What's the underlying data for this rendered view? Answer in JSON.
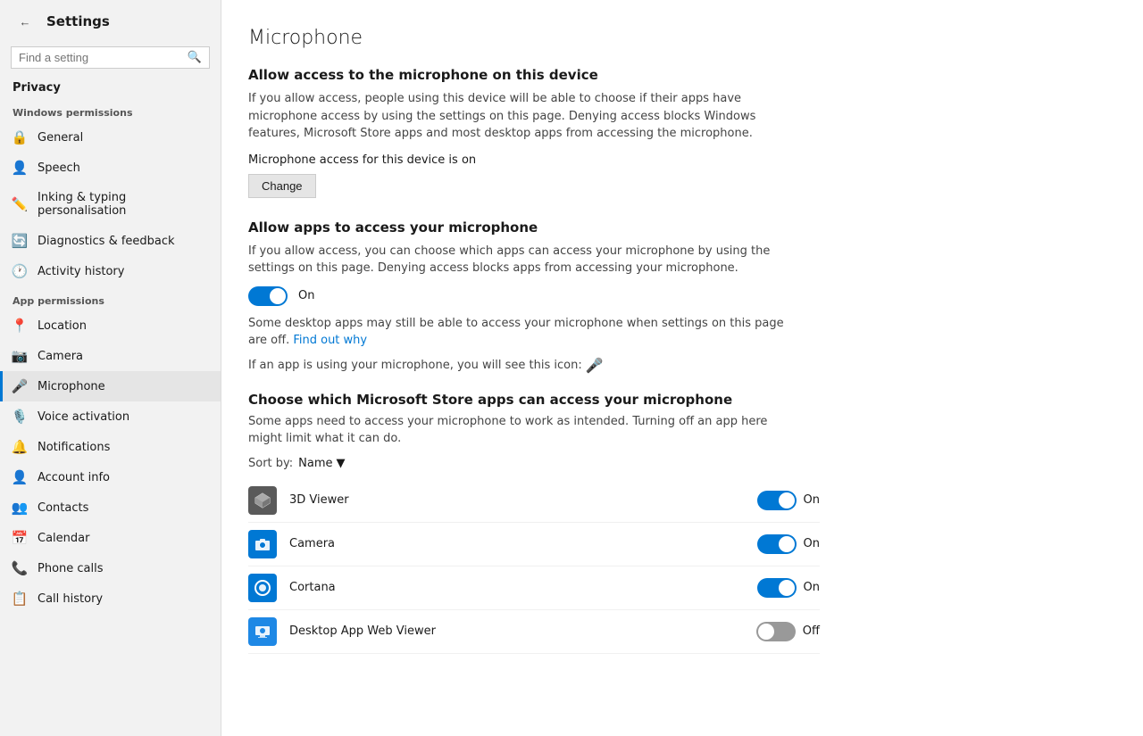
{
  "sidebar": {
    "title": "Settings",
    "search_placeholder": "Find a setting",
    "privacy_label": "Privacy",
    "windows_permissions_label": "Windows permissions",
    "app_permissions_label": "App permissions",
    "nav_items_windows": [
      {
        "id": "general",
        "label": "General",
        "icon": "🔒"
      },
      {
        "id": "speech",
        "label": "Speech",
        "icon": "👤"
      },
      {
        "id": "inking",
        "label": "Inking & typing personalisation",
        "icon": "✏️"
      },
      {
        "id": "diagnostics",
        "label": "Diagnostics & feedback",
        "icon": "🔄"
      },
      {
        "id": "activity",
        "label": "Activity history",
        "icon": "🕐"
      }
    ],
    "nav_items_app": [
      {
        "id": "location",
        "label": "Location",
        "icon": "📍"
      },
      {
        "id": "camera",
        "label": "Camera",
        "icon": "📷"
      },
      {
        "id": "microphone",
        "label": "Microphone",
        "icon": "🎤",
        "active": true
      },
      {
        "id": "voice",
        "label": "Voice activation",
        "icon": "🎙️"
      },
      {
        "id": "notifications",
        "label": "Notifications",
        "icon": "🔔"
      },
      {
        "id": "account",
        "label": "Account info",
        "icon": "👤"
      },
      {
        "id": "contacts",
        "label": "Contacts",
        "icon": "👥"
      },
      {
        "id": "calendar",
        "label": "Calendar",
        "icon": "📅"
      },
      {
        "id": "phone",
        "label": "Phone calls",
        "icon": "📞"
      },
      {
        "id": "callhistory",
        "label": "Call history",
        "icon": "📋"
      }
    ]
  },
  "main": {
    "page_title": "Microphone",
    "section1_title": "Allow access to the microphone on this device",
    "section1_desc": "If you allow access, people using this device will be able to choose if their apps have microphone access by using the settings on this page. Denying access blocks Windows features, Microsoft Store apps and most desktop apps from accessing the microphone.",
    "status_text": "Microphone access for this device is on",
    "change_btn_label": "Change",
    "section2_title": "Allow apps to access your microphone",
    "section2_desc": "If you allow access, you can choose which apps can access your microphone by using the settings on this page. Denying access blocks apps from accessing your microphone.",
    "toggle_main_state": "on",
    "toggle_main_label": "On",
    "desktop_note": "Some desktop apps may still be able to access your microphone when settings on this page are off.",
    "find_out_why": "Find out why",
    "mic_icon_note": "If an app is using your microphone, you will see this icon:",
    "section3_title": "Choose which Microsoft Store apps can access your microphone",
    "section3_desc": "Some apps need to access your microphone to work as intended. Turning off an app here might limit what it can do.",
    "sort_label": "Sort by:",
    "sort_value": "Name",
    "apps": [
      {
        "id": "3dviewer",
        "name": "3D Viewer",
        "icon_type": "3d",
        "icon_char": "⬡",
        "state": "on",
        "state_label": "On"
      },
      {
        "id": "camera",
        "name": "Camera",
        "icon_type": "camera",
        "icon_char": "📷",
        "state": "on",
        "state_label": "On"
      },
      {
        "id": "cortana",
        "name": "Cortana",
        "icon_type": "cortana",
        "icon_char": "⭕",
        "state": "on",
        "state_label": "On"
      },
      {
        "id": "desktopweb",
        "name": "Desktop App Web Viewer",
        "icon_type": "desktop",
        "icon_char": "🌐",
        "state": "off",
        "state_label": "Off"
      }
    ]
  }
}
